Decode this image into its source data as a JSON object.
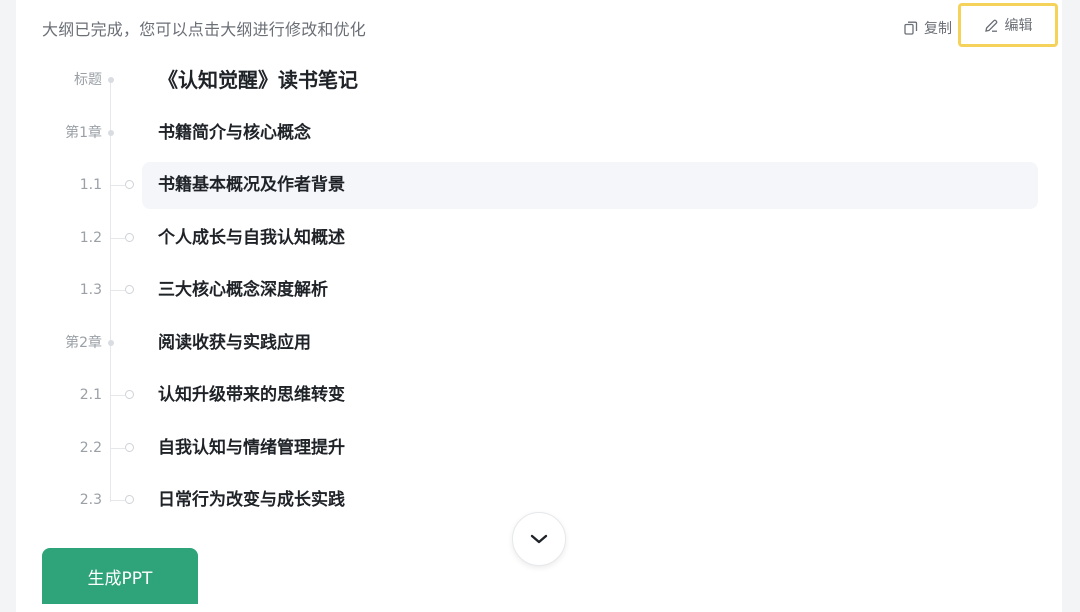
{
  "header": {
    "status_text": "大纲已完成，您可以点击大纲进行修改和优化",
    "copy_label": "复制",
    "edit_label": "编辑"
  },
  "outline": [
    {
      "num": "标题",
      "text": "《认知觉醒》读书笔记",
      "level": "title"
    },
    {
      "num": "第1章",
      "text": "书籍简介与核心概念",
      "level": "chapter"
    },
    {
      "num": "1.1",
      "text": "书籍基本概况及作者背景",
      "level": "section",
      "highlighted": true
    },
    {
      "num": "1.2",
      "text": "个人成长与自我认知概述",
      "level": "section"
    },
    {
      "num": "1.3",
      "text": "三大核心概念深度解析",
      "level": "section"
    },
    {
      "num": "第2章",
      "text": "阅读收获与实践应用",
      "level": "chapter"
    },
    {
      "num": "2.1",
      "text": "认知升级带来的思维转变",
      "level": "section"
    },
    {
      "num": "2.2",
      "text": "自我认知与情绪管理提升",
      "level": "section"
    },
    {
      "num": "2.3",
      "text": "日常行为改变与成长实践",
      "level": "section"
    }
  ],
  "actions": {
    "generate_label": "生成PPT"
  },
  "icons": {
    "copy": "copy-icon",
    "edit": "pencil-icon",
    "scroll": "chevron-down-icon"
  },
  "colors": {
    "accent_green": "#2fa37a",
    "edit_highlight_border": "#f5d35b",
    "row_highlight": "#f4f6f9"
  }
}
